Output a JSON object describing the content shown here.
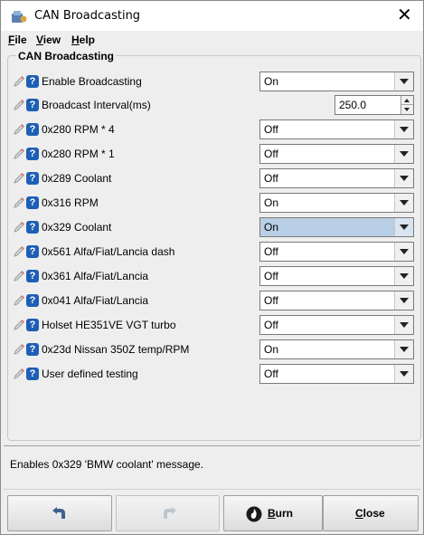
{
  "window": {
    "title": "CAN Broadcasting",
    "close_glyph": "✕"
  },
  "menu": {
    "items": [
      {
        "label_u": "F",
        "label_rest": "ile"
      },
      {
        "label_u": "V",
        "label_rest": "iew"
      },
      {
        "label_u": "H",
        "label_rest": "elp"
      }
    ]
  },
  "group": {
    "title": "CAN Broadcasting"
  },
  "help_glyph": "?",
  "rows": [
    {
      "label": "Enable Broadcasting",
      "value": "On"
    },
    {
      "label": "Broadcast Interval(ms)",
      "value": "250.0"
    },
    {
      "label": "0x280 RPM * 4",
      "value": "Off"
    },
    {
      "label": "0x280 RPM * 1",
      "value": "Off"
    },
    {
      "label": "0x289 Coolant",
      "value": "Off"
    },
    {
      "label": "0x316 RPM",
      "value": "On"
    },
    {
      "label": "0x329 Coolant",
      "value": "On"
    },
    {
      "label": "0x561 Alfa/Fiat/Lancia dash",
      "value": "Off"
    },
    {
      "label": "0x361 Alfa/Fiat/Lancia",
      "value": "Off"
    },
    {
      "label": "0x041 Alfa/Fiat/Lancia",
      "value": "Off"
    },
    {
      "label": "Holset HE351VE VGT turbo",
      "value": "Off"
    },
    {
      "label": "0x23d Nissan 350Z temp/RPM",
      "value": "On"
    },
    {
      "label": "User defined testing",
      "value": "Off"
    }
  ],
  "status": {
    "text": "Enables 0x329 'BMW coolant' message."
  },
  "buttons": {
    "undo_icon": "undo-icon",
    "redo_icon": "redo-icon",
    "burn_u": "B",
    "burn_rest": "urn",
    "close_u": "C",
    "close_rest": "lose"
  },
  "colors": {
    "help_badge": "#1d5fb4",
    "active_combo": "#b8cfe5"
  }
}
